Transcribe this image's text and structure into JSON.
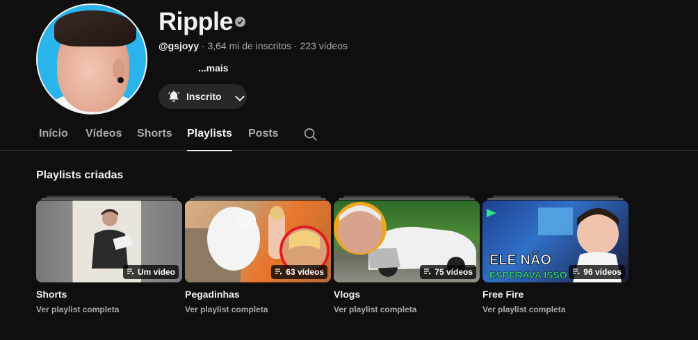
{
  "channel": {
    "name": "Ripple",
    "handle": "@gsjoyy",
    "subscribers": "3,64 mi de inscritos",
    "video_count": "223 vídeos",
    "separator": "·",
    "more_label": "...mais",
    "subscribe_label": "Inscrito"
  },
  "tabs": [
    {
      "label": "Início"
    },
    {
      "label": "Vídeos"
    },
    {
      "label": "Shorts"
    },
    {
      "label": "Playlists",
      "active": true
    },
    {
      "label": "Posts"
    }
  ],
  "section": {
    "title": "Playlists criadas"
  },
  "playlists": [
    {
      "title": "Shorts",
      "count": "Um vídeo",
      "link": "Ver playlist completa"
    },
    {
      "title": "Pegadinhas",
      "count": "63 vídeos",
      "link": "Ver playlist completa"
    },
    {
      "title": "Vlogs",
      "count": "75 vídeos",
      "link": "Ver playlist completa"
    },
    {
      "title": "Free Fire",
      "count": "96 vídeos",
      "link": "Ver playlist completa"
    }
  ],
  "thumbnails": {
    "free_fire_text_1": "ELE NÃO",
    "free_fire_text_2": "ESPERAVA ISSO"
  },
  "icons": {
    "verified": "verified-check-icon",
    "bell": "bell-icon",
    "chevron": "chevron-down-icon",
    "search": "search-icon",
    "playlist": "playlist-icon"
  },
  "colors": {
    "background": "#0f0f0f",
    "avatar_bg": "#29b4ec",
    "button_bg": "#272727",
    "text_secondary": "#aaaaaa"
  }
}
